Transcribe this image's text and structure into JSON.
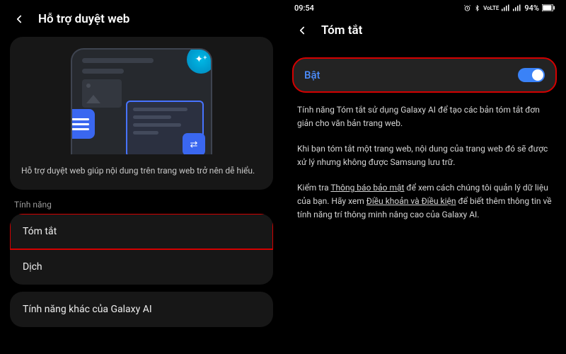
{
  "left": {
    "header_title": "Hỗ trợ duyệt web",
    "hero_desc": "Hỗ trợ duyệt web giúp nội dung trên trang web trở nên dễ hiểu.",
    "section_label": "Tính năng",
    "features": [
      {
        "label": "Tóm tắt"
      },
      {
        "label": "Dịch"
      }
    ],
    "more": {
      "label": "Tính năng khác của Galaxy AI"
    }
  },
  "right": {
    "status": {
      "time": "09:54",
      "battery": "94%"
    },
    "header_title": "Tóm tắt",
    "toggle": {
      "label": "Bật",
      "on": true
    },
    "para1": "Tính năng Tóm tắt sử dụng Galaxy AI để tạo các bản tóm tắt đơn giản cho văn bản trang web.",
    "para2": "Khi bạn tóm tắt một trang web, nội dung của trang web đó sẽ được xử lý nhưng không được Samsung lưu trữ.",
    "para3_a": "Kiểm tra ",
    "para3_link1": "Thông báo bảo mật",
    "para3_b": " để xem cách chúng tôi quản lý dữ liệu của bạn. Hãy xem ",
    "para3_link2": "Điều khoản và Điều kiện",
    "para3_c": " để biết thêm thông tin về tính năng trí thông minh nâng cao của Galaxy AI."
  }
}
